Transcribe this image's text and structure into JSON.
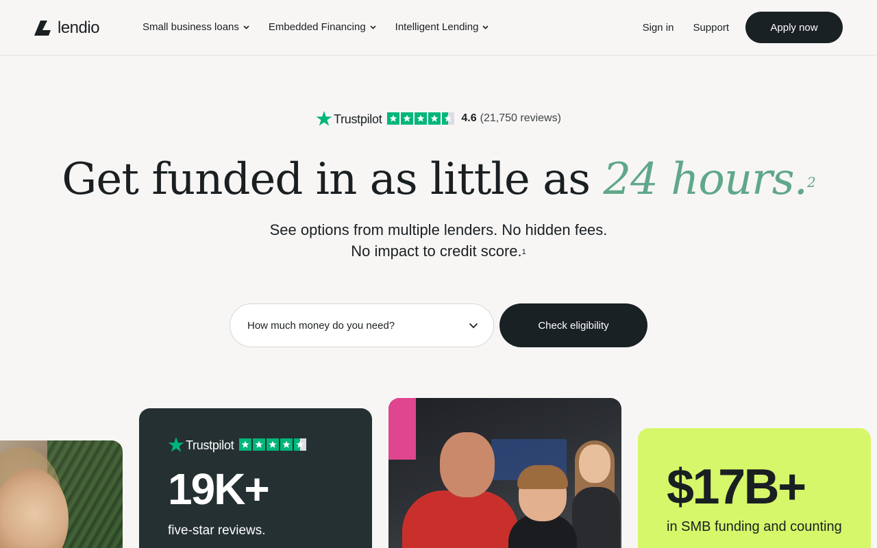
{
  "header": {
    "logo_text": "lendio",
    "nav": [
      {
        "label": "Small business loans"
      },
      {
        "label": "Embedded Financing"
      },
      {
        "label": "Intelligent Lending"
      }
    ],
    "sign_in": "Sign in",
    "support": "Support",
    "apply_label": "Apply now"
  },
  "hero": {
    "trustpilot_brand": "Trustpilot",
    "rating": "4.6",
    "reviews": "(21,750 reviews)",
    "headline_main": "Get funded in as little as ",
    "headline_accent": "24 hours.",
    "headline_footnote": "2",
    "sub_line1": "See options from multiple lenders. No hidden fees.",
    "sub_line2": "No impact to credit score.",
    "sub_footnote": "1",
    "amount_placeholder": "How much money do you need?",
    "check_label": "Check eligibility"
  },
  "cards": {
    "reviews_card": {
      "brand": "Trustpilot",
      "stat": "19K+",
      "caption": "five-star reviews."
    },
    "funding_card": {
      "stat": "$17B+",
      "caption": "in SMB funding and counting"
    }
  },
  "colors": {
    "accent_green": "#5fa889",
    "trustpilot_green": "#00b67a",
    "dark_button": "#1a2124",
    "lime_card": "#d6f76a",
    "dark_card": "#253032"
  },
  "icons": [
    "lendio-logo-icon",
    "chevron-down-icon",
    "trustpilot-star-icon",
    "star-icon"
  ]
}
